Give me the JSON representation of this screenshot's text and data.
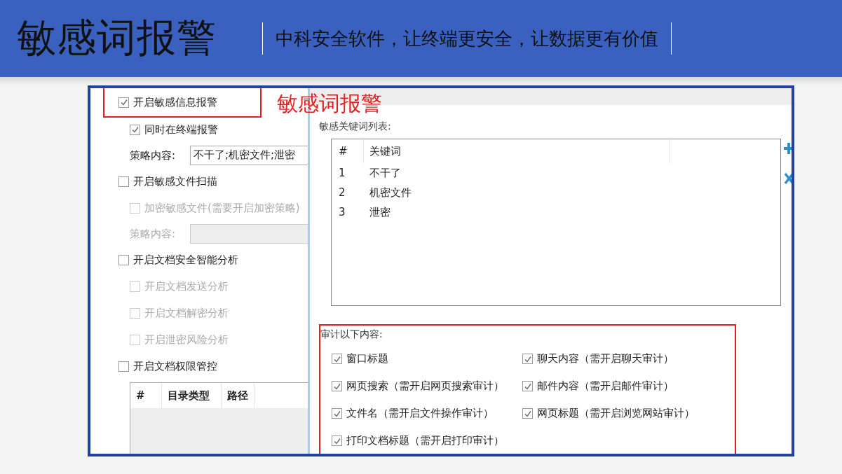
{
  "header": {
    "title": "敏感词报警",
    "slogan": "中科安全软件，让终端更安全，让数据更有价值"
  },
  "annotation": {
    "text": "敏感词报警"
  },
  "left_panel": {
    "items": [
      {
        "kind": "checkbox",
        "label": "开启敏感信息报警",
        "checked": true,
        "disabled": false,
        "highlighted": true,
        "children": [
          {
            "kind": "checkbox",
            "label": "同时在终端报警",
            "checked": true,
            "disabled": false,
            "highlighted": false
          },
          {
            "kind": "field",
            "label": "策略内容:",
            "value": "不干了;机密文件;泄密",
            "disabled": false
          }
        ]
      },
      {
        "kind": "checkbox",
        "label": "开启敏感文件扫描",
        "checked": false,
        "disabled": false,
        "highlighted": false,
        "children": [
          {
            "kind": "checkbox",
            "label": "加密敏感文件(需要开启加密策略)",
            "checked": false,
            "disabled": true,
            "highlighted": false
          },
          {
            "kind": "field",
            "label": "策略内容:",
            "disabled": true
          }
        ]
      },
      {
        "kind": "checkbox",
        "label": "开启文档安全智能分析",
        "checked": false,
        "disabled": false,
        "highlighted": false,
        "children": [
          {
            "kind": "checkbox",
            "label": "开启文档发送分析",
            "checked": false,
            "disabled": true,
            "highlighted": false
          },
          {
            "kind": "checkbox",
            "label": "开启文档解密分析",
            "checked": false,
            "disabled": true,
            "highlighted": false
          },
          {
            "kind": "checkbox",
            "label": "开启泄密风险分析",
            "checked": false,
            "disabled": true,
            "highlighted": false
          }
        ]
      },
      {
        "kind": "checkbox",
        "label": "开启文档权限管控",
        "checked": false,
        "disabled": false,
        "highlighted": false,
        "children": [
          {
            "kind": "table",
            "columns": [
              "#",
              "目录类型",
              "路径"
            ]
          }
        ]
      }
    ]
  },
  "keyword_list": {
    "label": "敏感关键词列表:",
    "columns": [
      "#",
      "关键词"
    ],
    "rows": [
      {
        "number": "1",
        "keyword": "不干了"
      },
      {
        "number": "2",
        "keyword": "机密文件"
      },
      {
        "number": "3",
        "keyword": "泄密"
      }
    ]
  },
  "audit": {
    "label": "审计以下内容:",
    "items": [
      {
        "label": "窗口标题",
        "checked": true
      },
      {
        "label": "聊天内容（需开启聊天审计）",
        "checked": true
      },
      {
        "label": "网页搜索（需开启网页搜索审计）",
        "checked": true
      },
      {
        "label": "邮件内容（需开启邮件审计）",
        "checked": true
      },
      {
        "label": "文件名（需开启文件操作审计）",
        "checked": true
      },
      {
        "label": "网页标题（需开启浏览网站审计）",
        "checked": true
      },
      {
        "label": "打印文档标题（需开启打印审计）",
        "checked": true
      }
    ]
  }
}
